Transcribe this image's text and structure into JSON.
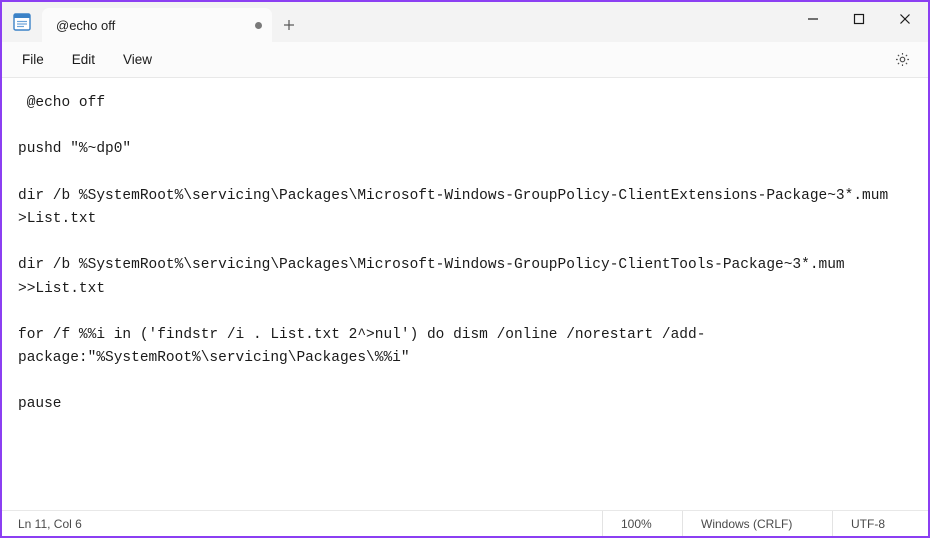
{
  "titlebar": {
    "tabs": [
      {
        "title": "@echo off",
        "dirty": true
      }
    ]
  },
  "menubar": {
    "items": [
      "File",
      "Edit",
      "View"
    ]
  },
  "editor": {
    "content": " @echo off\n\npushd \"%~dp0\"\n\ndir /b %SystemRoot%\\servicing\\Packages\\Microsoft-Windows-GroupPolicy-ClientExtensions-Package~3*.mum >List.txt\n\ndir /b %SystemRoot%\\servicing\\Packages\\Microsoft-Windows-GroupPolicy-ClientTools-Package~3*.mum >>List.txt\n\nfor /f %%i in ('findstr /i . List.txt 2^>nul') do dism /online /norestart /add-package:\"%SystemRoot%\\servicing\\Packages\\%%i\"\n\npause"
  },
  "statusbar": {
    "position": "Ln 11, Col 6",
    "zoom": "100%",
    "line_ending": "Windows (CRLF)",
    "encoding": "UTF-8"
  }
}
